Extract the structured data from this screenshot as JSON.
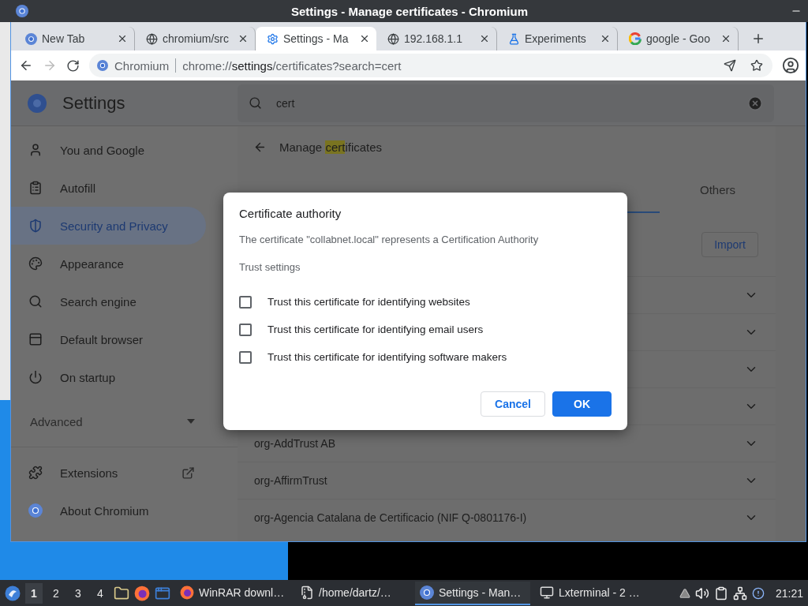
{
  "window": {
    "title": "Settings - Manage certificates - Chromium"
  },
  "tabs": [
    {
      "label": "New Tab",
      "kind": "chrome",
      "selected": false
    },
    {
      "label": "chromium/src",
      "kind": "globe",
      "selected": false
    },
    {
      "label": "Settings - Ma",
      "kind": "gear",
      "selected": true
    },
    {
      "label": "192.168.1.1",
      "kind": "globe",
      "selected": false
    },
    {
      "label": "Experiments",
      "kind": "flask",
      "selected": false
    },
    {
      "label": "google - Goo",
      "kind": "google",
      "selected": false
    }
  ],
  "toolbar": {
    "site": "Chromium",
    "url": "chrome://**settings**/certificates?search=cert"
  },
  "settings": {
    "title": "Settings",
    "search": {
      "value": "cert"
    }
  },
  "sidebar": {
    "items": [
      {
        "label": "You and Google",
        "kind": "person",
        "selected": false
      },
      {
        "label": "Autofill",
        "kind": "clipboard",
        "selected": false
      },
      {
        "label": "Security and Privacy",
        "kind": "shield",
        "selected": true
      },
      {
        "label": "Appearance",
        "kind": "palette",
        "selected": false
      },
      {
        "label": "Search engine",
        "kind": "search",
        "selected": false
      },
      {
        "label": "Default browser",
        "kind": "browser",
        "selected": false
      },
      {
        "label": "On startup",
        "kind": "power",
        "selected": false
      }
    ],
    "advanced": {
      "label": "Advanced",
      "expanded": false
    },
    "bottom_items": [
      {
        "label": "Extensions",
        "kind": "puzzle",
        "external": true
      },
      {
        "label": "About Chromium",
        "kind": "chrome",
        "external": false
      }
    ]
  },
  "page": {
    "heading": {
      "before": "Manage ",
      "match": "cert",
      "after": "ificates"
    },
    "cert_tabs": [
      {
        "label": "Others",
        "selected": false
      }
    ],
    "import_button": "Import",
    "certificates": [
      {
        "expanded": false
      },
      {
        "expanded": false
      },
      {
        "expanded": false
      },
      {
        "expanded": false
      },
      {
        "label": "org-AddTrust AB",
        "expanded": false
      },
      {
        "label": "org-AffirmTrust",
        "expanded": false
      },
      {
        "label": "org-Agencia Catalana de Certificacio (NIF Q-0801176-I)",
        "expanded": false
      }
    ]
  },
  "dialog": {
    "title": "Certificate authority",
    "message": "The certificate \"collabnet.local\" represents a Certification Authority",
    "section": "Trust settings",
    "options": [
      {
        "label": "Trust this certificate for identifying websites",
        "checked": false
      },
      {
        "label": "Trust this certificate for identifying email users",
        "checked": false
      },
      {
        "label": "Trust this certificate for identifying software makers",
        "checked": false
      }
    ],
    "buttons": [
      {
        "label": "Cancel",
        "kind": "secondary"
      },
      {
        "label": "OK",
        "kind": "primary"
      }
    ]
  },
  "taskbar": {
    "workspaces": [
      {
        "label": "1",
        "selected": true
      },
      {
        "label": "2",
        "selected": false
      },
      {
        "label": "3",
        "selected": false
      },
      {
        "label": "4",
        "selected": false
      }
    ],
    "tasks": [
      {
        "label": "WinRAR downl…",
        "kind": "firefox",
        "selected": false
      },
      {
        "label": "/home/dartz/…",
        "kind": "archive",
        "selected": false
      },
      {
        "label": "Settings - Man…",
        "kind": "chrome",
        "selected": true
      },
      {
        "label": "Lxterminal - 2 …",
        "kind": "monitor",
        "selected": false
      }
    ],
    "clock": "21:21"
  }
}
